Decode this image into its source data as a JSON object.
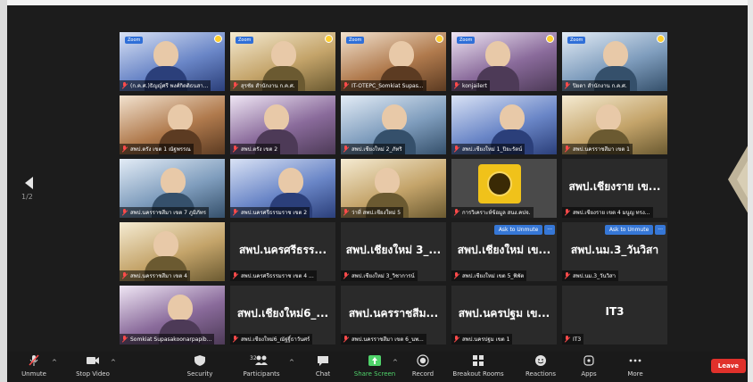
{
  "pagination": {
    "current": "1/2"
  },
  "tiles": [
    {
      "name": "(ก.ค.ศ.)ธิญญ์ศรี พงศ์กิตติธนสา...",
      "kind": "video",
      "active": true
    },
    {
      "name": "สุรชัย สำนักงาน ก.ค.ศ.",
      "kind": "video"
    },
    {
      "name": "IT-OTEPC_Somkiat Supas...",
      "kind": "video"
    },
    {
      "name": "konjailert",
      "kind": "video"
    },
    {
      "name": "ปิยดา สำนักงาน ก.ค.ศ.",
      "kind": "video"
    },
    {
      "name": "สพป.ตรัง เขต 1 ณัฐพรรณ",
      "kind": "video"
    },
    {
      "name": "สพป.ตรัง เขต 2",
      "kind": "video"
    },
    {
      "name": "สพป.เชียงใหม่ 2_ภัทริ",
      "kind": "video"
    },
    {
      "name": "สพป.เชียงใหม่ 1_ปิยะรัตน์",
      "kind": "video"
    },
    {
      "name": "สพป.นครราชสีมา เขต 1",
      "kind": "video"
    },
    {
      "name": "สพป.นครราชสีมา เขต 7 ภูมิภัทร",
      "kind": "video"
    },
    {
      "name": "สพป.นครศรีธรรมราช เขต 2",
      "kind": "video"
    },
    {
      "name": "ว่าที่ สพป.เชียงใหม่ 5",
      "kind": "video"
    },
    {
      "name": "การวิเคราะห์ข้อมูล สนง.คปจ.",
      "kind": "seal"
    },
    {
      "name": "สพป.เชียงราย เขต 4 มนูญ ทรง...",
      "kind": "text",
      "display": "สพป.เชียงราย เข..."
    },
    {
      "name": "สพป.นครราชสีมา เขต 4",
      "kind": "video"
    },
    {
      "name": "สพป.นครศรีธรรมราช เขต 4 ...",
      "kind": "text",
      "display": "สพป.นครศรีธรร..."
    },
    {
      "name": "สพป.เชียงใหม่ 3_วิชาการน์",
      "kind": "text",
      "display": "สพป.เชียงใหม่ 3_..."
    },
    {
      "name": "สพป.เชียงใหม่ เขต 5_พิพัต",
      "kind": "text",
      "display": "สพป.เชียงใหม่ เข...",
      "ask": true
    },
    {
      "name": "สพป.นม.3_วันวิสา",
      "kind": "text",
      "display": "สพป.นม.3_วันวิสา",
      "ask": true
    },
    {
      "name": "Somkiat Supasakoonarpapib...",
      "kind": "video"
    },
    {
      "name": "สพป.เชียงใหม่6_ณัฐฐิ์ธาวันศร์",
      "kind": "text",
      "display": "สพป.เชียงใหม่6_..."
    },
    {
      "name": "สพป.นครราชสีมา เขต 6_นพ...",
      "kind": "text",
      "display": "สพป.นครราชสีม..."
    },
    {
      "name": "สพป.นครปฐม เขต 1",
      "kind": "text",
      "display": "สพป.นครปฐม เข..."
    },
    {
      "name": "IT3",
      "kind": "text",
      "display": "IT3"
    }
  ],
  "ask_to_unmute": "Ask to Unmute",
  "ask_more": "···",
  "zoom_badge": "Zoom",
  "toolbar": {
    "unmute": "Unmute",
    "stop_video": "Stop Video",
    "security": "Security",
    "participants": "Participants",
    "participants_count": "32",
    "chat": "Chat",
    "share_screen": "Share Screen",
    "record": "Record",
    "breakout_rooms": "Breakout Rooms",
    "reactions": "Reactions",
    "apps": "Apps",
    "more": "More",
    "leave": "Leave"
  },
  "colors": {
    "accent_green": "#4fd36a",
    "leave_red": "#e0312b",
    "active_speaker": "#ffd83d",
    "ask_blue": "#3677d6"
  }
}
